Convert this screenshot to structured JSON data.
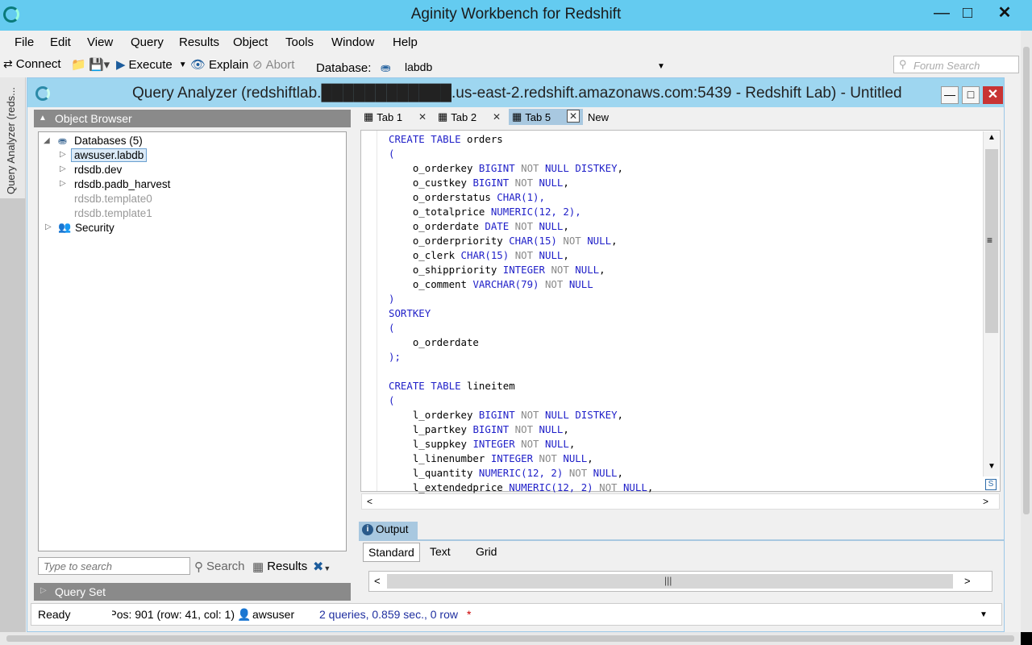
{
  "app": {
    "title": "Aginity Workbench for Redshift"
  },
  "menu": [
    "File",
    "Edit",
    "View",
    "Query",
    "Results",
    "Object",
    "Tools",
    "Window",
    "Help"
  ],
  "toolbar": {
    "connect": "Connect",
    "execute": "Execute",
    "explain": "Explain",
    "abort": "Abort",
    "database_label": "Database:",
    "database_value": "labdb",
    "search_placeholder": "Forum Search"
  },
  "side_tab": {
    "label": "Query Analyzer (reds..."
  },
  "query_analyzer": {
    "title": "Query Analyzer (redshiftlab.████████████.us-east-2.redshift.amazonaws.com:5439 - Redshift Lab) - Untitled"
  },
  "object_browser": {
    "title": "Object Browser",
    "databases": "Databases (5)",
    "items": [
      "awsuser.labdb",
      "rdsdb.dev",
      "rdsdb.padb_harvest",
      "rdsdb.template0",
      "rdsdb.template1"
    ],
    "security": "Security",
    "search_placeholder": "Type to search",
    "search_label": "Search",
    "results_label": "Results"
  },
  "query_set": {
    "title": "Query Set"
  },
  "tabs": [
    {
      "label": "Tab 1",
      "active": false
    },
    {
      "label": "Tab 2",
      "active": false
    },
    {
      "label": "Tab 5",
      "active": true
    },
    {
      "label": "New",
      "active": false
    }
  ],
  "code_lines": [
    "CREATE TABLE orders",
    "(",
    "    o_orderkey BIGINT NOT NULL DISTKEY,",
    "    o_custkey BIGINT NOT NULL,",
    "    o_orderstatus CHAR(1),",
    "    o_totalprice NUMERIC(12, 2),",
    "    o_orderdate DATE NOT NULL,",
    "    o_orderpriority CHAR(15) NOT NULL,",
    "    o_clerk CHAR(15) NOT NULL,",
    "    o_shippriority INTEGER NOT NULL,",
    "    o_comment VARCHAR(79) NOT NULL",
    ")",
    "SORTKEY",
    "(",
    "    o_orderdate",
    ");",
    "",
    "CREATE TABLE lineitem",
    "(",
    "    l_orderkey BIGINT NOT NULL DISTKEY,",
    "    l_partkey BIGINT NOT NULL,",
    "    l_suppkey INTEGER NOT NULL,",
    "    l_linenumber INTEGER NOT NULL,",
    "    l_quantity NUMERIC(12, 2) NOT NULL,",
    "    l_extendedprice NUMERIC(12, 2) NOT NULL,"
  ],
  "output": {
    "title": "Output",
    "tabs": [
      "Standard",
      "Text",
      "Grid"
    ],
    "active_tab": "Standard"
  },
  "status": {
    "state": "Ready",
    "position": "Pos: 901 (row: 41, col: 1)",
    "user": "awsuser",
    "summary": "2 queries, 0.859 sec., 0 row",
    "marker": "*"
  },
  "colors": {
    "titlebar": "#64cbf0",
    "keyword": "#1f1fc8",
    "close": "#c83434",
    "status_summary": "#1f2fa0"
  }
}
